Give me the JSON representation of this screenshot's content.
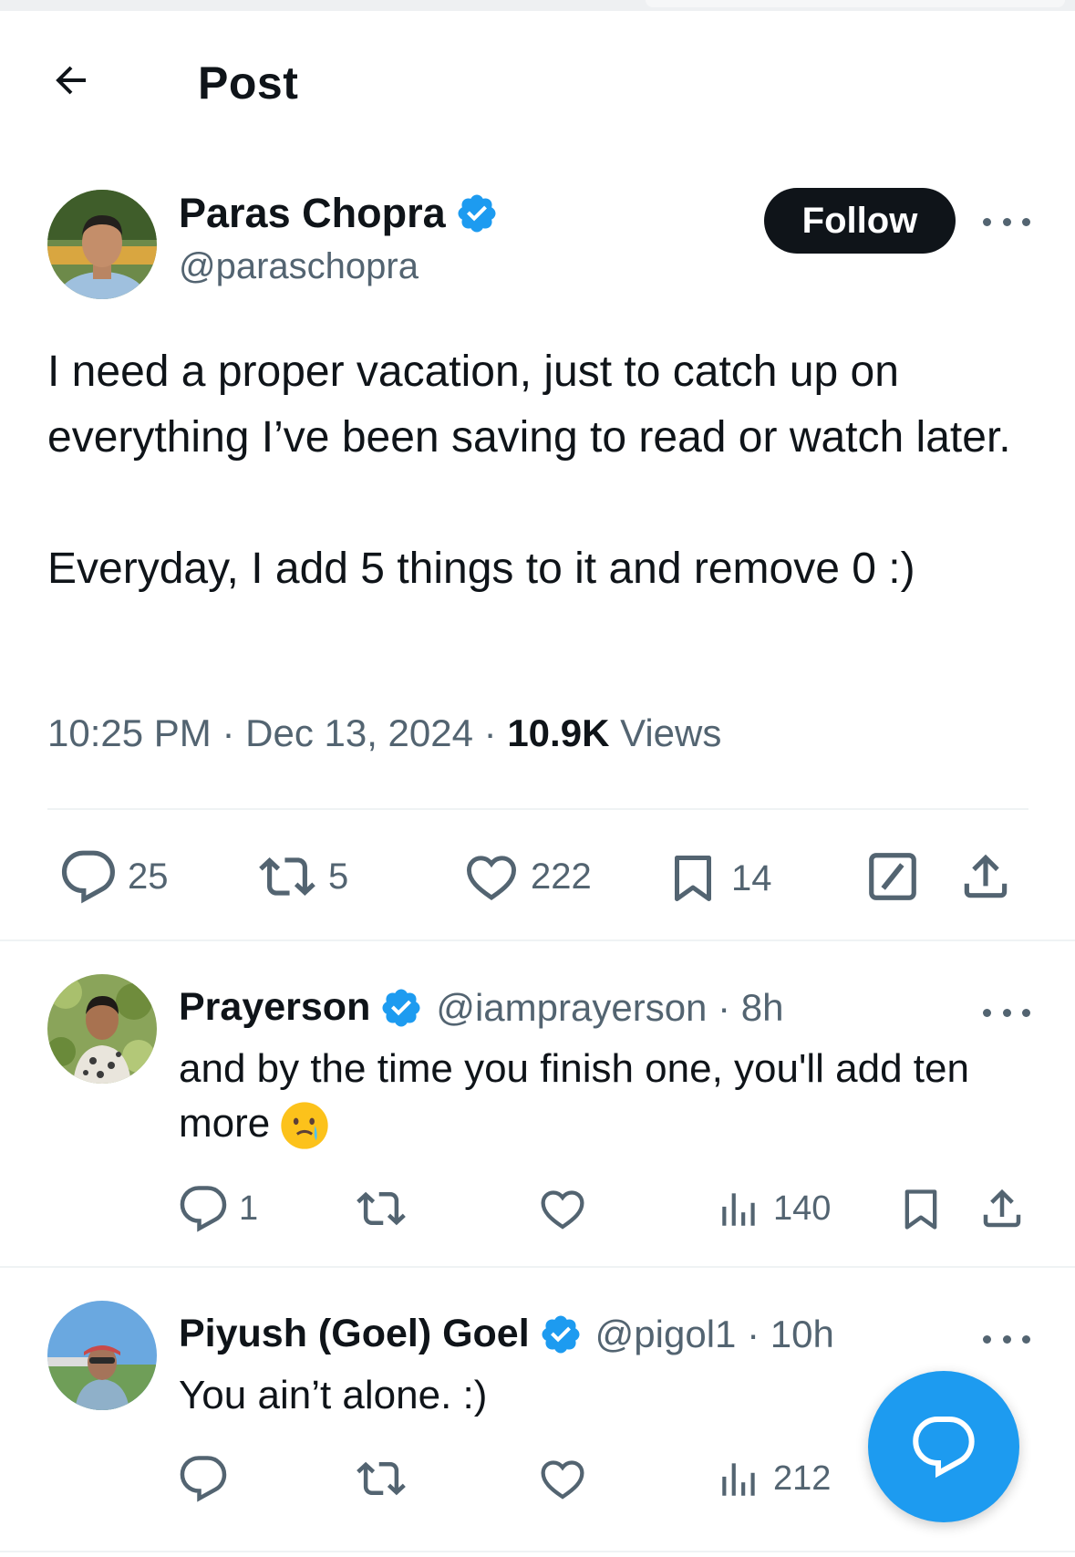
{
  "header": {
    "title": "Post"
  },
  "post": {
    "author": {
      "name": "Paras Chopra",
      "handle": "@paraschopra"
    },
    "follow_label": "Follow",
    "text_paragraphs": [
      "I need a proper vacation, just to catch up on everything I’ve been saving to read or watch later.",
      "Everyday, I add 5 things to it and remove 0 :)"
    ],
    "time": "10:25 PM",
    "separator": "·",
    "date": "Dec 13, 2024",
    "views_count": "10.9K",
    "views_label": "Views",
    "stats": {
      "replies": "25",
      "reposts": "5",
      "likes": "222",
      "bookmarks": "14"
    }
  },
  "replies": [
    {
      "name": "Prayerson",
      "handle": "@iamprayerson · 8h",
      "text": "and by the time you finish one, you'll add ten more",
      "stats": {
        "replies": "1",
        "reposts": "",
        "likes": "",
        "views": "140"
      }
    },
    {
      "name": "Piyush (Goel) Goel",
      "handle": "@pigol1 · 10h",
      "text": "You ain’t alone. :)",
      "stats": {
        "replies": "",
        "reposts": "",
        "likes": "",
        "views": "212"
      }
    }
  ],
  "colors": {
    "accent": "#1d9bf0",
    "text": "#0f1419",
    "muted": "#536471",
    "follow_bg": "#0f1419"
  },
  "icons": [
    "back-arrow-icon",
    "verified-badge-icon",
    "more-icon",
    "reply-icon",
    "repost-icon",
    "like-icon",
    "bookmark-icon",
    "grok-icon",
    "share-icon",
    "views-icon",
    "crying-face-emoji",
    "compose-reply-icon"
  ]
}
